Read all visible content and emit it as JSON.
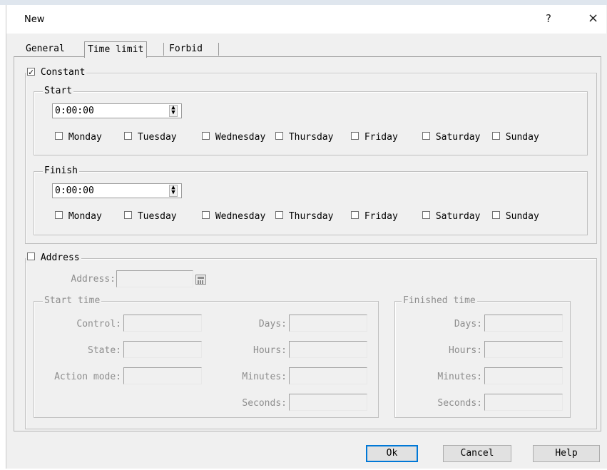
{
  "window": {
    "title": "New",
    "help_glyph": "?",
    "close_glyph": "×"
  },
  "tabs": [
    {
      "label": "General"
    },
    {
      "label": "Time limit"
    },
    {
      "label": "Forbid"
    }
  ],
  "constant": {
    "label": "Constant",
    "checked": true,
    "check_glyph": "✓",
    "start": {
      "label": "Start",
      "time": "0:00:00",
      "days": [
        "Monday",
        "Tuesday",
        "Wednesday",
        "Thursday",
        "Friday",
        "Saturday",
        "Sunday"
      ]
    },
    "finish": {
      "label": "Finish",
      "time": "0:00:00",
      "days": [
        "Monday",
        "Tuesday",
        "Wednesday",
        "Thursday",
        "Friday",
        "Saturday",
        "Sunday"
      ]
    }
  },
  "address": {
    "label": "Address",
    "checked": false,
    "field_label": "Address:",
    "field_value": "",
    "start_time": {
      "label": "Start time",
      "control_label": "Control:",
      "state_label": "State:",
      "action_mode_label": "Action mode:",
      "days_label": "Days:",
      "hours_label": "Hours:",
      "minutes_label": "Minutes:",
      "seconds_label": "Seconds:"
    },
    "finished_time": {
      "label": "Finished time",
      "days_label": "Days:",
      "hours_label": "Hours:",
      "minutes_label": "Minutes:",
      "seconds_label": "Seconds:"
    }
  },
  "buttons": {
    "ok": "Ok",
    "cancel": "Cancel",
    "help": "Help"
  },
  "icons": {
    "spin_up": "▲",
    "spin_down": "▼",
    "calculator": "calculator-icon"
  }
}
